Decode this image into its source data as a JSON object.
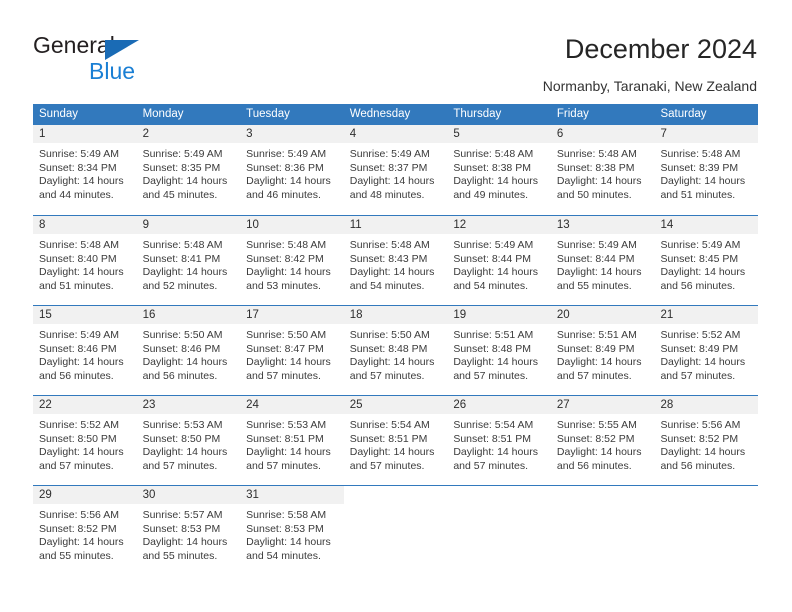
{
  "brand": {
    "name_top": "General",
    "name_bottom": "Blue",
    "accent_color": "#1a7fd4",
    "triangle_color": "#1a6bb5"
  },
  "header": {
    "title": "December 2024",
    "subtitle": "Normanby, Taranaki, New Zealand"
  },
  "calendar": {
    "header_bg": "#3279bd",
    "header_text_color": "#ffffff",
    "daynum_bg": "#f1f1f1",
    "weekdays": [
      "Sunday",
      "Monday",
      "Tuesday",
      "Wednesday",
      "Thursday",
      "Friday",
      "Saturday"
    ],
    "weeks": [
      [
        {
          "day": "1",
          "sunrise": "Sunrise: 5:49 AM",
          "sunset": "Sunset: 8:34 PM",
          "daylight_line1": "Daylight: 14 hours",
          "daylight_line2": "and 44 minutes."
        },
        {
          "day": "2",
          "sunrise": "Sunrise: 5:49 AM",
          "sunset": "Sunset: 8:35 PM",
          "daylight_line1": "Daylight: 14 hours",
          "daylight_line2": "and 45 minutes."
        },
        {
          "day": "3",
          "sunrise": "Sunrise: 5:49 AM",
          "sunset": "Sunset: 8:36 PM",
          "daylight_line1": "Daylight: 14 hours",
          "daylight_line2": "and 46 minutes."
        },
        {
          "day": "4",
          "sunrise": "Sunrise: 5:49 AM",
          "sunset": "Sunset: 8:37 PM",
          "daylight_line1": "Daylight: 14 hours",
          "daylight_line2": "and 48 minutes."
        },
        {
          "day": "5",
          "sunrise": "Sunrise: 5:48 AM",
          "sunset": "Sunset: 8:38 PM",
          "daylight_line1": "Daylight: 14 hours",
          "daylight_line2": "and 49 minutes."
        },
        {
          "day": "6",
          "sunrise": "Sunrise: 5:48 AM",
          "sunset": "Sunset: 8:38 PM",
          "daylight_line1": "Daylight: 14 hours",
          "daylight_line2": "and 50 minutes."
        },
        {
          "day": "7",
          "sunrise": "Sunrise: 5:48 AM",
          "sunset": "Sunset: 8:39 PM",
          "daylight_line1": "Daylight: 14 hours",
          "daylight_line2": "and 51 minutes."
        }
      ],
      [
        {
          "day": "8",
          "sunrise": "Sunrise: 5:48 AM",
          "sunset": "Sunset: 8:40 PM",
          "daylight_line1": "Daylight: 14 hours",
          "daylight_line2": "and 51 minutes."
        },
        {
          "day": "9",
          "sunrise": "Sunrise: 5:48 AM",
          "sunset": "Sunset: 8:41 PM",
          "daylight_line1": "Daylight: 14 hours",
          "daylight_line2": "and 52 minutes."
        },
        {
          "day": "10",
          "sunrise": "Sunrise: 5:48 AM",
          "sunset": "Sunset: 8:42 PM",
          "daylight_line1": "Daylight: 14 hours",
          "daylight_line2": "and 53 minutes."
        },
        {
          "day": "11",
          "sunrise": "Sunrise: 5:48 AM",
          "sunset": "Sunset: 8:43 PM",
          "daylight_line1": "Daylight: 14 hours",
          "daylight_line2": "and 54 minutes."
        },
        {
          "day": "12",
          "sunrise": "Sunrise: 5:49 AM",
          "sunset": "Sunset: 8:44 PM",
          "daylight_line1": "Daylight: 14 hours",
          "daylight_line2": "and 54 minutes."
        },
        {
          "day": "13",
          "sunrise": "Sunrise: 5:49 AM",
          "sunset": "Sunset: 8:44 PM",
          "daylight_line1": "Daylight: 14 hours",
          "daylight_line2": "and 55 minutes."
        },
        {
          "day": "14",
          "sunrise": "Sunrise: 5:49 AM",
          "sunset": "Sunset: 8:45 PM",
          "daylight_line1": "Daylight: 14 hours",
          "daylight_line2": "and 56 minutes."
        }
      ],
      [
        {
          "day": "15",
          "sunrise": "Sunrise: 5:49 AM",
          "sunset": "Sunset: 8:46 PM",
          "daylight_line1": "Daylight: 14 hours",
          "daylight_line2": "and 56 minutes."
        },
        {
          "day": "16",
          "sunrise": "Sunrise: 5:50 AM",
          "sunset": "Sunset: 8:46 PM",
          "daylight_line1": "Daylight: 14 hours",
          "daylight_line2": "and 56 minutes."
        },
        {
          "day": "17",
          "sunrise": "Sunrise: 5:50 AM",
          "sunset": "Sunset: 8:47 PM",
          "daylight_line1": "Daylight: 14 hours",
          "daylight_line2": "and 57 minutes."
        },
        {
          "day": "18",
          "sunrise": "Sunrise: 5:50 AM",
          "sunset": "Sunset: 8:48 PM",
          "daylight_line1": "Daylight: 14 hours",
          "daylight_line2": "and 57 minutes."
        },
        {
          "day": "19",
          "sunrise": "Sunrise: 5:51 AM",
          "sunset": "Sunset: 8:48 PM",
          "daylight_line1": "Daylight: 14 hours",
          "daylight_line2": "and 57 minutes."
        },
        {
          "day": "20",
          "sunrise": "Sunrise: 5:51 AM",
          "sunset": "Sunset: 8:49 PM",
          "daylight_line1": "Daylight: 14 hours",
          "daylight_line2": "and 57 minutes."
        },
        {
          "day": "21",
          "sunrise": "Sunrise: 5:52 AM",
          "sunset": "Sunset: 8:49 PM",
          "daylight_line1": "Daylight: 14 hours",
          "daylight_line2": "and 57 minutes."
        }
      ],
      [
        {
          "day": "22",
          "sunrise": "Sunrise: 5:52 AM",
          "sunset": "Sunset: 8:50 PM",
          "daylight_line1": "Daylight: 14 hours",
          "daylight_line2": "and 57 minutes."
        },
        {
          "day": "23",
          "sunrise": "Sunrise: 5:53 AM",
          "sunset": "Sunset: 8:50 PM",
          "daylight_line1": "Daylight: 14 hours",
          "daylight_line2": "and 57 minutes."
        },
        {
          "day": "24",
          "sunrise": "Sunrise: 5:53 AM",
          "sunset": "Sunset: 8:51 PM",
          "daylight_line1": "Daylight: 14 hours",
          "daylight_line2": "and 57 minutes."
        },
        {
          "day": "25",
          "sunrise": "Sunrise: 5:54 AM",
          "sunset": "Sunset: 8:51 PM",
          "daylight_line1": "Daylight: 14 hours",
          "daylight_line2": "and 57 minutes."
        },
        {
          "day": "26",
          "sunrise": "Sunrise: 5:54 AM",
          "sunset": "Sunset: 8:51 PM",
          "daylight_line1": "Daylight: 14 hours",
          "daylight_line2": "and 57 minutes."
        },
        {
          "day": "27",
          "sunrise": "Sunrise: 5:55 AM",
          "sunset": "Sunset: 8:52 PM",
          "daylight_line1": "Daylight: 14 hours",
          "daylight_line2": "and 56 minutes."
        },
        {
          "day": "28",
          "sunrise": "Sunrise: 5:56 AM",
          "sunset": "Sunset: 8:52 PM",
          "daylight_line1": "Daylight: 14 hours",
          "daylight_line2": "and 56 minutes."
        }
      ],
      [
        {
          "day": "29",
          "sunrise": "Sunrise: 5:56 AM",
          "sunset": "Sunset: 8:52 PM",
          "daylight_line1": "Daylight: 14 hours",
          "daylight_line2": "and 55 minutes."
        },
        {
          "day": "30",
          "sunrise": "Sunrise: 5:57 AM",
          "sunset": "Sunset: 8:53 PM",
          "daylight_line1": "Daylight: 14 hours",
          "daylight_line2": "and 55 minutes."
        },
        {
          "day": "31",
          "sunrise": "Sunrise: 5:58 AM",
          "sunset": "Sunset: 8:53 PM",
          "daylight_line1": "Daylight: 14 hours",
          "daylight_line2": "and 54 minutes."
        },
        {
          "day": "",
          "sunrise": "",
          "sunset": "",
          "daylight_line1": "",
          "daylight_line2": ""
        },
        {
          "day": "",
          "sunrise": "",
          "sunset": "",
          "daylight_line1": "",
          "daylight_line2": ""
        },
        {
          "day": "",
          "sunrise": "",
          "sunset": "",
          "daylight_line1": "",
          "daylight_line2": ""
        },
        {
          "day": "",
          "sunrise": "",
          "sunset": "",
          "daylight_line1": "",
          "daylight_line2": ""
        }
      ]
    ]
  }
}
